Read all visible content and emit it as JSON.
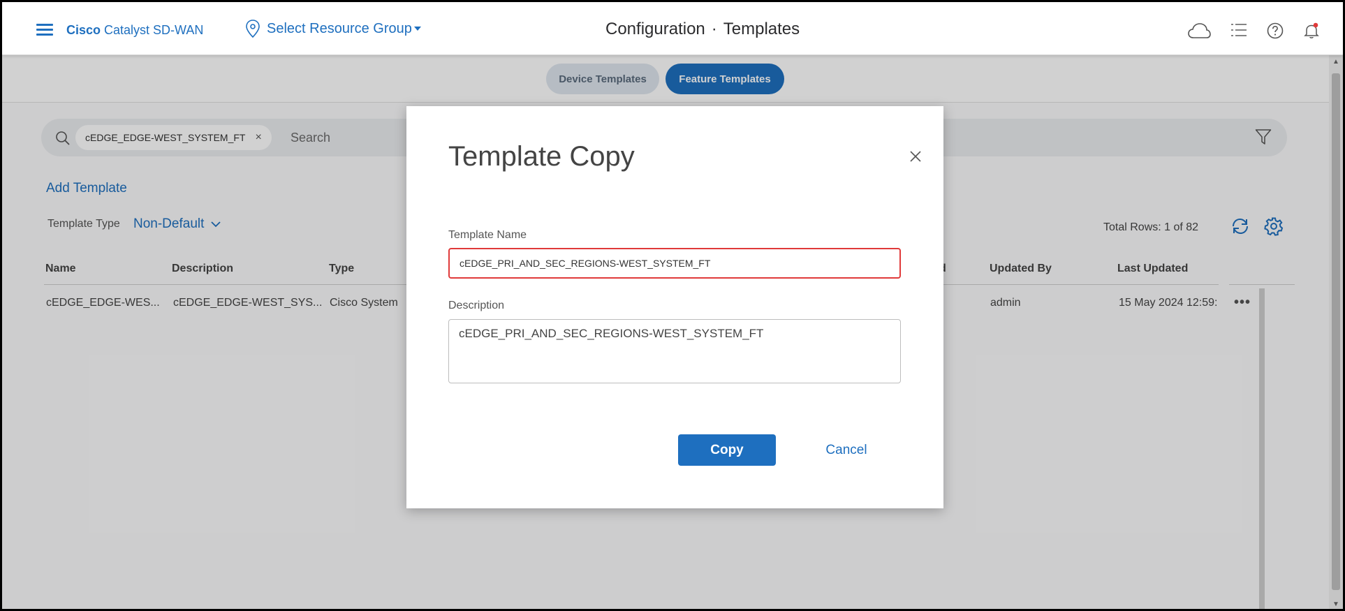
{
  "header": {
    "brand_bold": "Cisco",
    "brand_rest": " Catalyst SD-WAN",
    "resource_group": "Select Resource Group",
    "title_part1": "Configuration",
    "title_sep": "·",
    "title_part2": "Templates"
  },
  "tabs": [
    {
      "label": "Device Templates",
      "active": false
    },
    {
      "label": "Feature Templates",
      "active": true
    }
  ],
  "search": {
    "chip": "cEDGE_EDGE-WEST_SYSTEM_FT",
    "chip_close": "×",
    "placeholder": "Search"
  },
  "toolbar": {
    "add_template": "Add Template",
    "template_type_label": "Template Type",
    "template_type_value": "Non-Default",
    "total_rows": "Total Rows: 1 of 82"
  },
  "table": {
    "columns": [
      "Name",
      "Description",
      "Type",
      "d",
      "Updated By",
      "Last Updated"
    ],
    "rows": [
      [
        "cEDGE_EDGE-WES...",
        "cEDGE_EDGE-WEST_SYS...",
        "Cisco System",
        "admin",
        "15 May 2024 12:59:"
      ]
    ],
    "row_menu": "•••"
  },
  "modal": {
    "title": "Template Copy",
    "name_label": "Template Name",
    "name_value": "cEDGE_PRI_AND_SEC_REGIONS-WEST_SYSTEM_FT",
    "description_label": "Description",
    "description_value": "cEDGE_PRI_AND_SEC_REGIONS-WEST_SYSTEM_FT",
    "copy_label": "Copy",
    "cancel_label": "Cancel"
  },
  "colors": {
    "accent": "#1e6fbf",
    "highlight": "#e03a3a"
  }
}
